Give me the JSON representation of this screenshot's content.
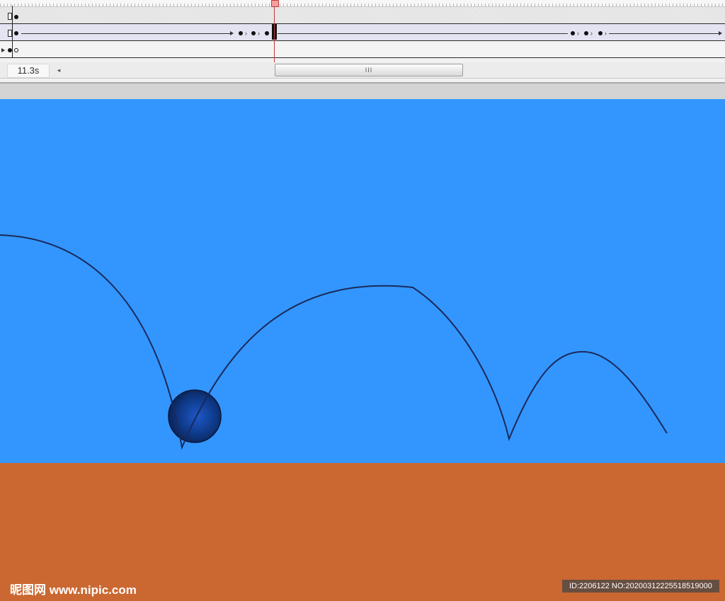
{
  "timeline": {
    "current_time": "11.3s",
    "scrollbar_grip": "III",
    "scroll_left_glyph": "◂"
  },
  "stage": {
    "sky_color": "#3396fe",
    "ground_color": "#cb6832",
    "ball_color": "#0b2f6e",
    "path_color": "#1a2a5c"
  },
  "watermark": {
    "site": "昵图网 www.nipic.com",
    "id_text": "ID:2206122 NO:20200312225518519000"
  }
}
